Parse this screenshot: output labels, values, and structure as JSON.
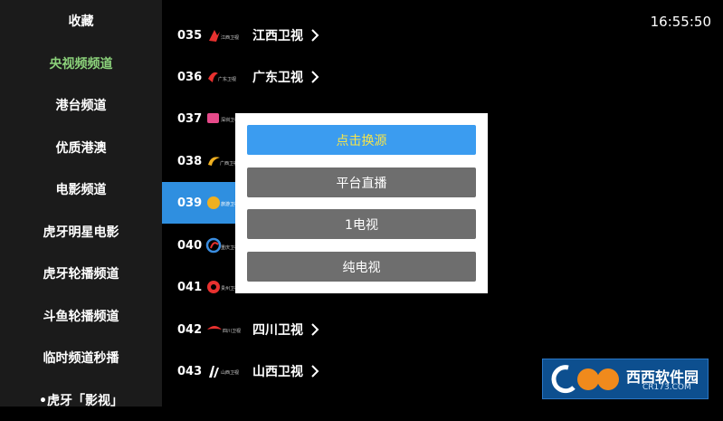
{
  "sidebar": {
    "items": [
      {
        "label": "收藏",
        "active": false
      },
      {
        "label": "央视频频道",
        "active": true
      },
      {
        "label": "港台频道",
        "active": false
      },
      {
        "label": "优质港澳",
        "active": false
      },
      {
        "label": "电影频道",
        "active": false
      },
      {
        "label": "虎牙明星电影",
        "active": false
      },
      {
        "label": "虎牙轮播频道",
        "active": false
      },
      {
        "label": "斗鱼轮播频道",
        "active": false
      },
      {
        "label": "临时频道秒播",
        "active": false
      },
      {
        "label": "•虎牙「影视」",
        "active": false
      }
    ]
  },
  "channels": [
    {
      "num": "035",
      "name": "江西卫视",
      "logo_text": "江西卫视",
      "color": "#e8312f"
    },
    {
      "num": "036",
      "name": "广东卫视",
      "logo_text": "广东卫视",
      "color": "#e8312f"
    },
    {
      "num": "037",
      "name": "",
      "logo_text": "深圳卫视",
      "color": "#e64a8a"
    },
    {
      "num": "038",
      "name": "",
      "logo_text": "广西卫视",
      "color": "#f0b020"
    },
    {
      "num": "039",
      "name": "",
      "logo_text": "旅游卫视",
      "color": "#f0b020"
    },
    {
      "num": "040",
      "name": "",
      "logo_text": "重庆卫视",
      "color": "#3a8de0"
    },
    {
      "num": "041",
      "name": "",
      "logo_text": "贵州卫视",
      "color": "#e8312f"
    },
    {
      "num": "042",
      "name": "四川卫视",
      "logo_text": "四川卫视",
      "color": "#e8312f"
    },
    {
      "num": "043",
      "name": "山西卫视",
      "logo_text": "山西卫视",
      "color": "#ffffff"
    }
  ],
  "selected_channel": "039",
  "clock": "16:55:50",
  "dialog": {
    "buttons": [
      "点击换源",
      "平台直播",
      "1电视",
      "纯电视"
    ]
  },
  "watermark": {
    "text": "西西软件园",
    "sub": "CR173.COM"
  },
  "colors": {
    "accent_green": "#8bd17a",
    "selected_blue": "#2f8fe0",
    "primary_button": "#3b9cf0",
    "primary_text": "#f5e44a",
    "secondary_button": "#6e6e6e"
  }
}
